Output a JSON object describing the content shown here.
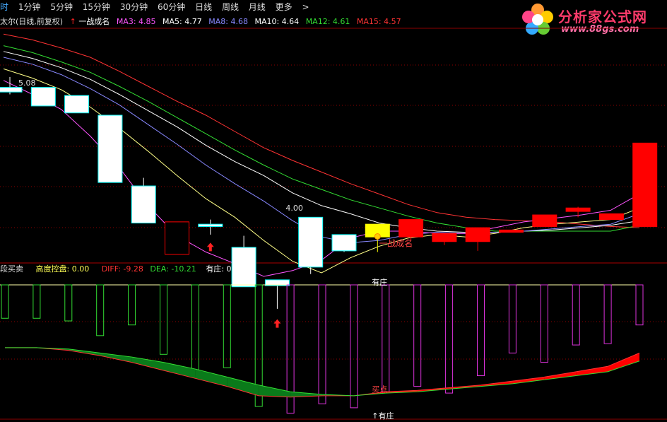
{
  "toolbar": {
    "items": [
      "时",
      "1分钟",
      "5分钟",
      "15分钟",
      "30分钟",
      "60分钟",
      "日线",
      "周线",
      "月线",
      "更多",
      ">"
    ]
  },
  "logo": {
    "name": "分析家公式网",
    "url": "www.88gs.com"
  },
  "main_legend": {
    "title": "太尔(日线,前复权)",
    "signal": "一战成名",
    "ma": [
      {
        "label": "MA3: 4.85",
        "color": "#ff55ff"
      },
      {
        "label": "MA5: 4.77",
        "color": "#ffffff"
      },
      {
        "label": "MA8: 4.68",
        "color": "#8888ff"
      },
      {
        "label": "MA10: 4.64",
        "color": "#ffffff"
      },
      {
        "label": "MA12: 4.61",
        "color": "#33dd33"
      },
      {
        "label": "MA15: 4.57",
        "color": "#ff3333"
      }
    ]
  },
  "sub_legend": {
    "title": "段买卖",
    "items": [
      {
        "label": "高度控盘: 0.00",
        "color": "#ffff55"
      },
      {
        "label": "DIFF: -9.28",
        "color": "#ff3333"
      },
      {
        "label": "DEA: -10.21",
        "color": "#33dd33"
      },
      {
        "label": "有庄: 0.00",
        "color": "#ffffff"
      }
    ]
  },
  "colors": {
    "up": "#ff0000",
    "down_fill": "#ffffff",
    "down_edge": "#00ffff",
    "yellow": "#ffff00",
    "grid": "#8b0000"
  },
  "chart_data": [
    {
      "type": "candlestick",
      "ylim": [
        3.55,
        5.55
      ],
      "price_labels": [
        {
          "text": "5.08",
          "value": 5.08,
          "index": 0
        },
        {
          "text": "4.00",
          "value": 4.0,
          "index": 8
        }
      ],
      "candles": [
        {
          "o": 5.04,
          "h": 5.13,
          "l": 4.98,
          "c": 5.0,
          "color": "down"
        },
        {
          "o": 5.04,
          "h": 5.04,
          "l": 4.88,
          "c": 4.88,
          "color": "down"
        },
        {
          "o": 4.97,
          "h": 4.97,
          "l": 4.82,
          "c": 4.82,
          "color": "down"
        },
        {
          "o": 4.8,
          "h": 4.8,
          "l": 4.22,
          "c": 4.22,
          "color": "down"
        },
        {
          "o": 4.19,
          "h": 4.26,
          "l": 3.87,
          "c": 3.87,
          "color": "down"
        },
        {
          "o": 3.88,
          "h": 3.88,
          "l": 3.6,
          "c": 3.6,
          "color": "up_hollow"
        },
        {
          "o": 3.86,
          "h": 3.9,
          "l": 3.77,
          "c": 3.84,
          "color": "down"
        },
        {
          "o": 3.66,
          "h": 3.76,
          "l": 3.32,
          "c": 3.32,
          "color": "down"
        },
        {
          "o": 3.38,
          "h": 3.38,
          "l": 3.13,
          "c": 3.33,
          "color": "down"
        },
        {
          "o": 3.49,
          "h": 3.92,
          "l": 3.43,
          "c": 3.92,
          "color": "down"
        },
        {
          "o": 3.77,
          "h": 3.77,
          "l": 3.62,
          "c": 3.63,
          "color": "down"
        },
        {
          "o": 3.75,
          "h": 3.86,
          "l": 3.62,
          "c": 3.86,
          "color": "yellow"
        },
        {
          "o": 3.75,
          "h": 3.9,
          "l": 3.72,
          "c": 3.9,
          "color": "up"
        },
        {
          "o": 3.71,
          "h": 3.78,
          "l": 3.68,
          "c": 3.78,
          "color": "up"
        },
        {
          "o": 3.71,
          "h": 3.83,
          "l": 3.63,
          "c": 3.83,
          "color": "up"
        },
        {
          "o": 3.79,
          "h": 3.81,
          "l": 3.79,
          "c": 3.81,
          "color": "up"
        },
        {
          "o": 3.84,
          "h": 3.94,
          "l": 3.84,
          "c": 3.94,
          "color": "up"
        },
        {
          "o": 3.97,
          "h": 4.01,
          "l": 3.92,
          "c": 4.0,
          "color": "up"
        },
        {
          "o": 3.9,
          "h": 3.95,
          "l": 3.9,
          "c": 3.95,
          "color": "up"
        },
        {
          "o": 3.84,
          "h": 4.56,
          "l": 3.84,
          "c": 4.56,
          "color": "up"
        }
      ],
      "ma_series": [
        {
          "name": "MA15",
          "color": "#ff3333",
          "values": [
            5.5,
            5.45,
            5.38,
            5.3,
            5.18,
            5.05,
            4.92,
            4.8,
            4.66,
            4.52,
            4.41,
            4.31,
            4.21,
            4.12,
            4.03,
            3.96,
            3.92,
            3.9,
            3.89,
            3.88,
            3.86,
            3.84,
            3.83
          ]
        },
        {
          "name": "MA12",
          "color": "#33dd33",
          "values": [
            5.4,
            5.34,
            5.26,
            5.17,
            5.05,
            4.92,
            4.78,
            4.64,
            4.5,
            4.37,
            4.25,
            4.16,
            4.07,
            4.0,
            3.93,
            3.87,
            3.83,
            3.8,
            3.8,
            3.8,
            3.8,
            3.8,
            3.85
          ]
        },
        {
          "name": "MA10",
          "color": "#ffffff",
          "values": [
            5.35,
            5.29,
            5.21,
            5.11,
            4.98,
            4.84,
            4.7,
            4.54,
            4.4,
            4.28,
            4.13,
            4.02,
            3.95,
            3.87,
            3.83,
            3.8,
            3.79,
            3.79,
            3.8,
            3.81,
            3.83,
            3.85,
            3.89
          ]
        },
        {
          "name": "MA8",
          "color": "#8888ff",
          "values": [
            5.3,
            5.24,
            5.15,
            5.03,
            4.89,
            4.72,
            4.55,
            4.37,
            4.21,
            4.06,
            3.89,
            3.75,
            3.7,
            3.72,
            3.77,
            3.79,
            3.78,
            3.79,
            3.8,
            3.82,
            3.84,
            3.86,
            3.95
          ]
        },
        {
          "name": "MA5",
          "color": "#ffff88",
          "values": [
            5.2,
            5.12,
            5.02,
            4.87,
            4.69,
            4.49,
            4.28,
            4.08,
            3.92,
            3.72,
            3.54,
            3.44,
            3.57,
            3.67,
            3.74,
            3.77,
            3.75,
            3.78,
            3.83,
            3.86,
            3.88,
            3.9,
            4.0
          ]
        },
        {
          "name": "MA3",
          "color": "#ff55ff",
          "values": [
            5.1,
            4.98,
            4.85,
            4.62,
            4.35,
            4.02,
            3.76,
            3.62,
            3.52,
            3.41,
            3.46,
            3.55,
            3.74,
            3.8,
            3.8,
            3.78,
            3.78,
            3.83,
            3.88,
            3.91,
            3.94,
            3.98,
            4.12
          ]
        }
      ],
      "annotations": [
        {
          "text": "一战成名",
          "index": 11,
          "value": 3.73,
          "color": "#ff4444"
        }
      ],
      "arrows": [
        {
          "index": 6,
          "value": 3.7
        },
        {
          "index": 8,
          "value": 3.04
        }
      ]
    },
    {
      "type": "macd",
      "ylim": [
        -1.0,
        0.0
      ],
      "bars": [
        {
          "v": -0.25,
          "color": "green"
        },
        {
          "v": -0.25,
          "color": "green"
        },
        {
          "v": -0.27,
          "color": "green"
        },
        {
          "v": -0.38,
          "color": "green"
        },
        {
          "v": -0.3,
          "color": "green"
        },
        {
          "v": -0.52,
          "color": "green"
        },
        {
          "v": -0.69,
          "color": "green"
        },
        {
          "v": -0.62,
          "color": "green"
        },
        {
          "v": -0.91,
          "color": "green"
        },
        {
          "v": -0.96,
          "color": "magenta"
        },
        {
          "v": -0.89,
          "color": "magenta"
        },
        {
          "v": -0.92,
          "color": "magenta"
        },
        {
          "v": -0.8,
          "color": "magenta"
        },
        {
          "v": -0.76,
          "color": "magenta"
        },
        {
          "v": -0.81,
          "color": "magenta"
        },
        {
          "v": -0.68,
          "color": "magenta"
        },
        {
          "v": -0.51,
          "color": "magenta"
        },
        {
          "v": -0.58,
          "color": "magenta"
        },
        {
          "v": -0.45,
          "color": "magenta"
        },
        {
          "v": -0.44,
          "color": "magenta"
        },
        {
          "v": -0.3,
          "color": "magenta"
        }
      ],
      "diff": [
        -0.47,
        -0.47,
        -0.49,
        -0.53,
        -0.58,
        -0.64,
        -0.7,
        -0.76,
        -0.83,
        -0.84,
        -0.83,
        -0.83,
        -0.8,
        -0.79,
        -0.77,
        -0.75,
        -0.72,
        -0.69,
        -0.65,
        -0.61,
        -0.51
      ],
      "dea": [
        -0.47,
        -0.47,
        -0.48,
        -0.51,
        -0.54,
        -0.58,
        -0.63,
        -0.69,
        -0.75,
        -0.8,
        -0.82,
        -0.83,
        -0.81,
        -0.8,
        -0.78,
        -0.76,
        -0.74,
        -0.71,
        -0.68,
        -0.65,
        -0.57
      ],
      "labels": [
        {
          "text": "买点",
          "index": 11,
          "value": -0.78,
          "color": "#ff4444"
        },
        {
          "text": "有庄",
          "index": 11,
          "value": -0.98,
          "color": "#ffffff"
        },
        {
          "text": "有庄",
          "index": 11,
          "value": 0.02,
          "color": "#ffffff"
        }
      ]
    }
  ]
}
